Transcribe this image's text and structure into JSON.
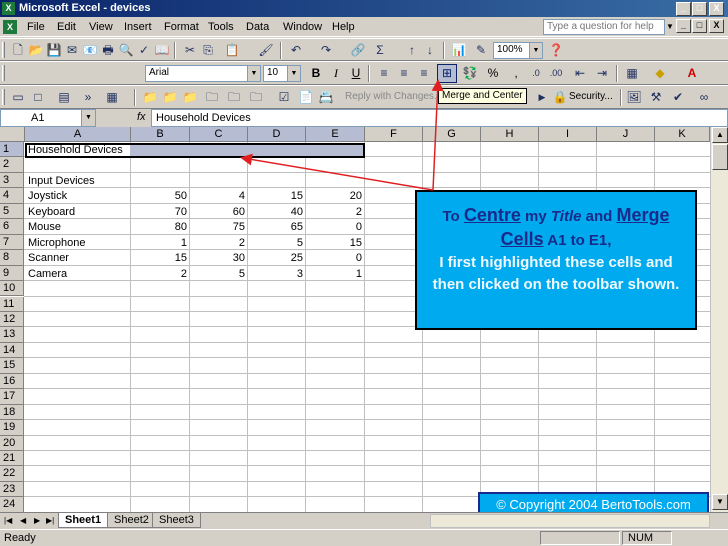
{
  "window": {
    "title": "Microsoft Excel - devices",
    "controls": [
      "_",
      "□",
      "X"
    ]
  },
  "menu": {
    "items": [
      "File",
      "Edit",
      "View",
      "Insert",
      "Format",
      "Tools",
      "Data",
      "Window",
      "Help"
    ],
    "help_placeholder": "Type a question for help",
    "doc_controls": [
      "_",
      "□",
      "X"
    ]
  },
  "toolbar": {
    "zoom": "100%",
    "font_name": "Arial",
    "font_size": "10",
    "bold": "B",
    "italic": "I",
    "underline": "U",
    "percent": "%",
    "comma": ",",
    "reply_with_changes": "Reply with Changes...",
    "security": "Security..."
  },
  "tooltip": {
    "merge_and_center": "Merge and Center"
  },
  "formula_bar": {
    "name_box": "A1",
    "fx": "fx",
    "content": "Household Devices"
  },
  "sheet": {
    "columns": [
      "A",
      "B",
      "C",
      "D",
      "E",
      "F",
      "G",
      "H",
      "I",
      "J",
      "K"
    ],
    "rows": [
      "1",
      "2",
      "3",
      "4",
      "5",
      "6",
      "7",
      "8",
      "9",
      "10",
      "11",
      "12",
      "13",
      "14",
      "15",
      "16",
      "17",
      "18",
      "19",
      "20",
      "21",
      "22",
      "23",
      "24"
    ],
    "title": "Household Devices",
    "section": "Input Devices",
    "data": [
      {
        "label": "Joystick",
        "values": [
          "50",
          "4",
          "15",
          "20"
        ]
      },
      {
        "label": "Keyboard",
        "values": [
          "70",
          "60",
          "40",
          "2"
        ]
      },
      {
        "label": "Mouse",
        "values": [
          "80",
          "75",
          "65",
          "0"
        ]
      },
      {
        "label": "Microphone",
        "values": [
          "1",
          "2",
          "5",
          "15"
        ]
      },
      {
        "label": "Scanner",
        "values": [
          "15",
          "30",
          "25",
          "0"
        ]
      },
      {
        "label": "Camera",
        "values": [
          "2",
          "5",
          "3",
          "1"
        ]
      }
    ]
  },
  "callout": {
    "to": "To",
    "centre": "Centre",
    "my": "my",
    "title": "Title",
    "and": "and",
    "merge": "Merge",
    "cells": "Cells",
    "range": "A1 to E1,",
    "rest": "I first highlighted these cells and then clicked on the toolbar shown."
  },
  "copyright": "© Copyright 2004 BertoTools.com",
  "tabs": [
    "Sheet1",
    "Sheet2",
    "Sheet3"
  ],
  "status": {
    "ready": "Ready",
    "num": "NUM"
  },
  "colors": {
    "callout_bg": "#00aaee",
    "arrow": "#e02020",
    "selection": "#b6bdd2",
    "title_bar": "#0a246a"
  }
}
